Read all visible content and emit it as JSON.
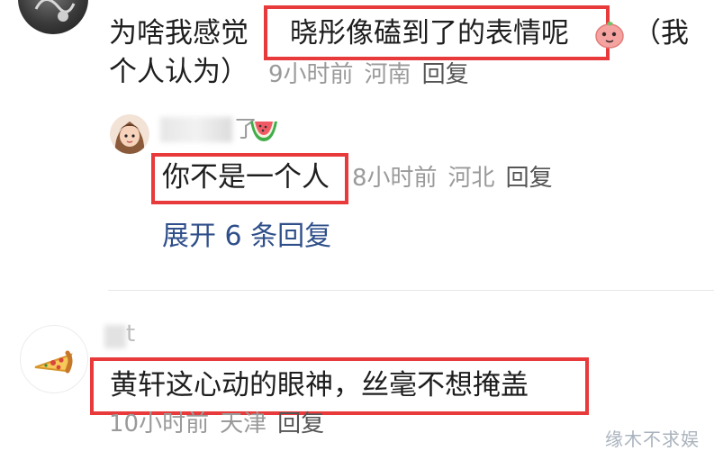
{
  "comment1": {
    "text_before": "为啥我感觉",
    "highlight": "晓彤像磕到了的表情呢",
    "text_after": "（我",
    "line2": "个人认为）",
    "time": "9小时前",
    "location": "河南",
    "reply_label": "回复",
    "emoji_icon": "peach-emoji-icon"
  },
  "reply1": {
    "username_suffix": "了",
    "username_emoji": "watermelon-emoji-icon",
    "highlight": "你不是一个人",
    "time": "8小时前",
    "location": "河北",
    "reply_label": "回复"
  },
  "expand_replies": "展开 6 条回复",
  "comment2": {
    "avatar_icon": "pizza-icon",
    "username_partial": "t",
    "highlight": "黄轩这心动的眼神，丝毫不想掩盖",
    "time": "10小时前",
    "location": "天津",
    "reply_label": "回复"
  },
  "watermark": "缘木不求娱",
  "colors": {
    "highlight_border": "#e8393b",
    "link_blue": "#2f4f8a",
    "meta_gray": "#9a9a9a"
  }
}
